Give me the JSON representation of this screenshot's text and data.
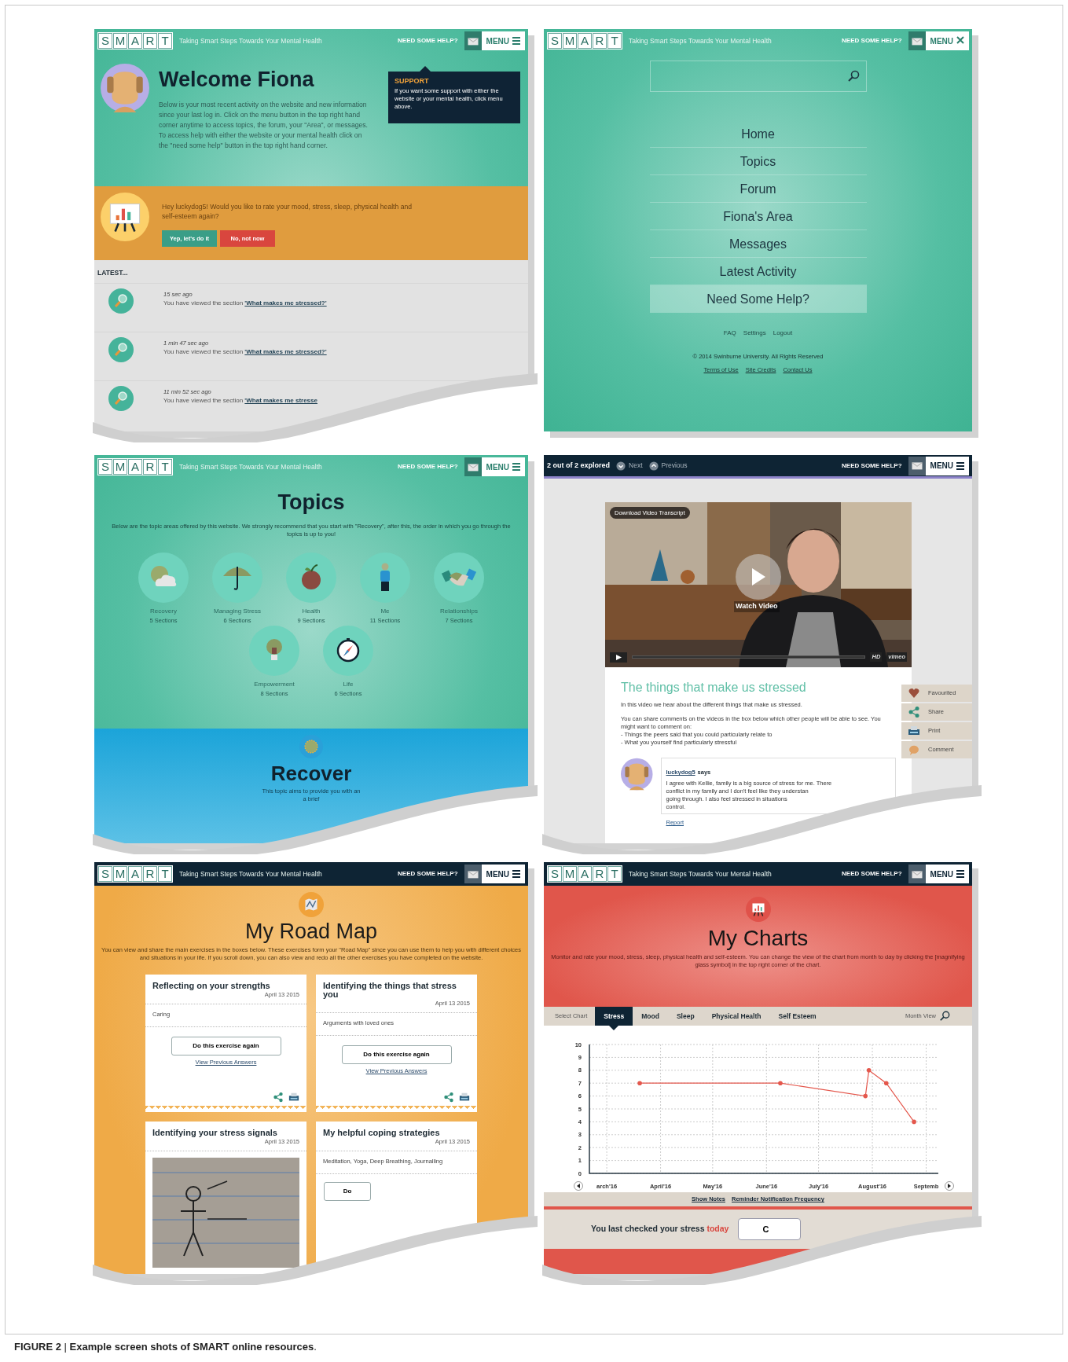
{
  "panels": [
    {
      "kind": "welcome",
      "header": {
        "logo": [
          "S",
          "M",
          "A",
          "R",
          "T"
        ],
        "tagline": "Taking Smart Steps Towards Your Mental Health",
        "help": "NEED SOME HELP?",
        "menu": "MENU",
        "menu_open": false
      },
      "title": "Welcome Fiona",
      "intro": "Below is your most recent activity on the website and new information since your last log in. Click on the menu button in the top right hand corner anytime to access topics, the forum, your \"Area\", or messages. To access help with either the website or your mental health click on the \"need some help\" button in the top right hand corner.",
      "support": {
        "title": "SUPPORT",
        "text": "If you want some support with either the website or your mental health, click menu above."
      },
      "prompt": {
        "text": "Hey luckydog5! Would you like to rate your mood, stress, sleep, physical health and self-esteem again?",
        "buttons": [
          {
            "label": "Yep, let's do it",
            "kind": "accept"
          },
          {
            "label": "No, not now",
            "kind": "decline"
          }
        ]
      },
      "latest_label": "LATEST...",
      "activity": [
        {
          "time": "15 sec ago",
          "text": "You have viewed the section",
          "link": "'What makes me stressed?'"
        },
        {
          "time": "1 min 47 sec ago",
          "text": "You have viewed the section",
          "link": "'What makes me stressed?'"
        },
        {
          "time": "11 min 52 sec ago",
          "text": "You have viewed the section",
          "link": "'What makes me stresse"
        }
      ]
    },
    {
      "kind": "menu",
      "header": {
        "logo": [
          "S",
          "M",
          "A",
          "R",
          "T"
        ],
        "tagline": "Taking Smart Steps Towards Your Mental Health",
        "help": "NEED SOME HELP?",
        "menu": "MENU",
        "menu_open": true
      },
      "nav": [
        {
          "label": "Home",
          "selected": false
        },
        {
          "label": "Topics",
          "selected": false
        },
        {
          "label": "Forum",
          "selected": false
        },
        {
          "label": "Fiona's Area",
          "selected": false
        },
        {
          "label": "Messages",
          "selected": false
        },
        {
          "label": "Latest Activity",
          "selected": false
        },
        {
          "label": "Need Some Help?",
          "selected": true
        }
      ],
      "footer_links": [
        "FAQ",
        "Settings",
        "Logout"
      ],
      "copyright": "© 2014 Swinburne University. All Rights Reserved",
      "legal_links": [
        "Terms of Use",
        "Site Credits",
        "Contact Us"
      ]
    },
    {
      "kind": "topics",
      "header": {
        "logo": [
          "S",
          "M",
          "A",
          "R",
          "T"
        ],
        "tagline": "Taking Smart Steps Towards Your Mental Health",
        "help": "NEED SOME HELP?",
        "menu": "MENU",
        "menu_open": false
      },
      "title": "Topics",
      "intro": "Below are the topic areas offered by this website. We strongly recommend that you start with \"Recovery\", after this, the order in which you go through the topics is up to you!",
      "topics": [
        {
          "name": "Recovery",
          "sections": "5 Sections",
          "kind": "cloud"
        },
        {
          "name": "Managing Stress",
          "sections": "6 Sections",
          "kind": "umbrella"
        },
        {
          "name": "Health",
          "sections": "9 Sections",
          "kind": "apple"
        },
        {
          "name": "Me",
          "sections": "11 Sections",
          "kind": "person"
        },
        {
          "name": "Relationships",
          "sections": "7 Sections",
          "kind": "handshake"
        },
        {
          "name": "Empowerment",
          "sections": "8 Sections",
          "kind": "bulb"
        },
        {
          "name": "Life",
          "sections": "6 Sections",
          "kind": "compass"
        }
      ],
      "section": {
        "title": "Recover",
        "lines": [
          "This topic aims to provide you with an",
          "a brief"
        ]
      }
    },
    {
      "kind": "video",
      "header": {
        "progress": "2 out of 2 explored",
        "nav": [
          {
            "label": "Next",
            "kind": "down"
          },
          {
            "label": "Previous",
            "kind": "up"
          }
        ],
        "help": "NEED SOME HELP?",
        "menu": "MENU",
        "menu_open": false
      },
      "video": {
        "kind": "picture",
        "transcript": "Download Video Transcript",
        "caption": "Watch Video",
        "quality": "HD",
        "player": "vimeo"
      },
      "title": "The things that make us stressed",
      "paragraphs": [
        "In this video we hear about the different things that make us stressed.",
        "You can share comments on the videos in the box below which other people will be able to see. You might want to comment on:",
        "- Things the peers said that you could particularly relate to",
        "- What you yourself find particularly stressful"
      ],
      "actions": [
        {
          "label": "Favourited",
          "kind": "heart"
        },
        {
          "label": "Share",
          "kind": "share"
        },
        {
          "label": "Print",
          "kind": "print"
        },
        {
          "label": "Comment",
          "kind": "comment"
        }
      ],
      "comment": {
        "author": "luckydog5",
        "says": "says",
        "lines": [
          "I agree with Kellie, family is a big source of stress for me. There",
          "conflict in my family and I don't feel like they understan",
          "going through. I also feel stressed in situations",
          "control."
        ],
        "report": "Report"
      }
    },
    {
      "kind": "roadmap",
      "header": {
        "logo": [
          "S",
          "M",
          "A",
          "R",
          "T"
        ],
        "tagline": "Taking Smart Steps Towards Your Mental Health",
        "help": "NEED SOME HELP?",
        "menu": "MENU",
        "menu_open": false
      },
      "title": "My Road Map",
      "intro": "You can view and share the main exercises in the boxes below. These exercises form your \"Road Map\" since you can use them to help you with different choices and situations in your life. If you scroll down, you can also view and redo all the other exercises you have completed on the website.",
      "cards": [
        {
          "kind": "answer",
          "title": "Reflecting on your strengths",
          "date": "April 13 2015",
          "answer": "Caring",
          "button": "Do this exercise again",
          "link": "View Previous Answers",
          "share_print": true
        },
        {
          "kind": "answer",
          "title": "Identifying the things that stress you",
          "date": "April 13 2015",
          "answer": "Arguments with loved ones",
          "button": "Do this exercise again",
          "link": "View Previous Answers",
          "share_print": true
        },
        {
          "kind": "picture",
          "title": "Identifying your stress signals",
          "date": "April 13 2015"
        },
        {
          "kind": "answer",
          "title": "My helpful coping strategies",
          "date": "April 13 2015",
          "answer": "Meditation, Yoga, Deep Breathing, Journalling",
          "button": "Do"
        }
      ]
    },
    {
      "kind": "charts",
      "header": {
        "logo": [
          "S",
          "M",
          "A",
          "R",
          "T"
        ],
        "tagline": "Taking Smart Steps Towards Your Mental Health",
        "help": "NEED SOME HELP?",
        "menu": "MENU",
        "menu_open": false
      },
      "title": "My Charts",
      "intro": "Monitor and rate your mood, stress, sleep, physical health and self-esteem. You can change the view of the chart from month to day by clicking the [magnifying glass symbol] in the top right corner of the chart.",
      "select_label": "Select Chart",
      "tabs": [
        {
          "label": "Stress",
          "selected": true
        },
        {
          "label": "Mood",
          "selected": false
        },
        {
          "label": "Sleep",
          "selected": false
        },
        {
          "label": "Physical Health",
          "selected": false
        },
        {
          "label": "Self Esteem",
          "selected": false
        }
      ],
      "view_label": "Month View",
      "chart_data": {
        "type": "line",
        "grid": true,
        "x": [
          "2016-03-20",
          "2016-06-09",
          "2016-07-28",
          "2016-07-30",
          "2016-08-09",
          "2016-08-25"
        ],
        "series": [
          {
            "color": "#e4574c",
            "values": [
              7,
              7,
              6,
              8,
              7,
              4
            ]
          }
        ],
        "xlim": [
          "2016-02-20",
          "2016-09-08"
        ],
        "ylim": [
          0,
          10
        ],
        "yticks": [
          0,
          1,
          2,
          3,
          4,
          5,
          6,
          7,
          8,
          9,
          10
        ],
        "xticks": [
          {
            "value": "2016-03-01",
            "label": "arch'16"
          },
          {
            "value": "2016-04-01",
            "label": "April'16"
          },
          {
            "value": "2016-05-01",
            "label": "May'16"
          },
          {
            "value": "2016-06-01",
            "label": "June'16"
          },
          {
            "value": "2016-07-01",
            "label": "July'16"
          },
          {
            "value": "2016-08-01",
            "label": "August'16"
          },
          {
            "value": "2016-09-01",
            "label": "Septemb"
          }
        ]
      },
      "links": [
        "Show Notes",
        "Reminder Notification Frequency"
      ],
      "status": {
        "text": "You last checked your stress",
        "highlight": "today",
        "button": "C"
      }
    }
  ],
  "caption": "**FIGURE 2** | **Example screen shots of SMART online resources**."
}
